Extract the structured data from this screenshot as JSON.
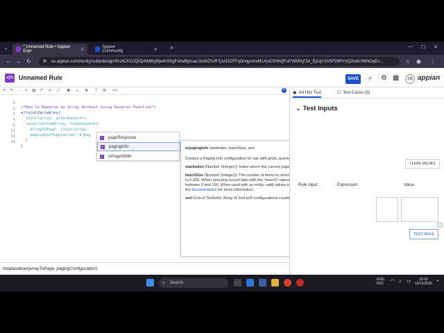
{
  "browser": {
    "tabs": [
      {
        "label": "* Unnamed Rule • Appian Expr",
        "active": true
      },
      {
        "label": "Appian Community",
        "active": false
      }
    ],
    "url": "us.appian.community/suite/design/9zsltCKOJQiZpNMl6gRje4nSSgFvbwByxsaLGeWZrUR7j1ADt2FFqOnqyumvMLAtoC5HhQFul7WMXyiTel_EjzojV1hSP99RYnQ2bdd-RbNOqEx..."
  },
  "header": {
    "rule_title": "Unnamed Rule",
    "save_label": "SAVE",
    "avatar_initials": "SM",
    "brand": "appian"
  },
  "code_lines": [
    {
      "n": "1",
      "text": "/*How to Reverse an Array Without using Reverse Function*/"
    },
    {
      "n": "2",
      "text": "a!localVariables("
    },
    {
      "n": "3",
      "text": "  local!array: a!forEach(==),"
    },
    {
      "n": "4",
      "text": "  local!sortedArray: todatasubset("
    },
    {
      "n": "5",
      "text": "    arrayToPage: local!array,"
    },
    {
      "n": "12",
      "text": "    pagingConfiguration: a!pag"
    },
    {
      "n": "13",
      "text": "  )"
    },
    {
      "n": "14",
      "text": ")"
    }
  ],
  "autocomplete": {
    "items": [
      "pageResponse",
      "pagingInfo",
      "isPageWidth"
    ],
    "selected_index": 1
  },
  "doc": {
    "signature_name": "a!pagingInfo",
    "signature_params": " startIndex, batchSize, sort",
    "description": "Creates a Paging Info configuration for use with grids, queries, and todatasubset().",
    "p1_name": "startIndex",
    "p1_text": " (Number (Integer)): Index where the current page begins. It must be greater than zero.",
    "p2_name": "batchSize",
    "p2_text": " (Number (Integer)): The number of items to return. When used with records, valid values are 0 to 5,000. When querying record data with the \"search\" operator used in a!queryFilter, valid values are between 0 and 100. When used with an entity, valid values include those greater than or equal to -1. See the ",
    "p2_link": "documentation",
    "p2_tail": " for more information.",
    "p3_name": "sort",
    "p3_text": " (List of SortInfo): Array of Sort Info configurations created with a!sortInfo()."
  },
  "signature_bar": {
    "fn": "todatasubset",
    "params": "arrayToPage, pagingConfiguration"
  },
  "right_panel": {
    "tab_adhoc": "Ad Hoc Test",
    "tab_cases": "Test Cases (0)",
    "title": "Test Inputs",
    "clear_label": "CLEAR VALUES",
    "col_rule_input": "Rule Input",
    "col_expression": "Expression",
    "col_value": "Value",
    "test_rule_label": "TEST RULE"
  },
  "taskbar": {
    "search_label": "Search",
    "lang": "ENG",
    "lang2": "INTL",
    "time": "20:43",
    "date": "16/12/2025"
  },
  "colors": {
    "accent": "#1b4fd1",
    "purple": "#7d3bc7"
  }
}
